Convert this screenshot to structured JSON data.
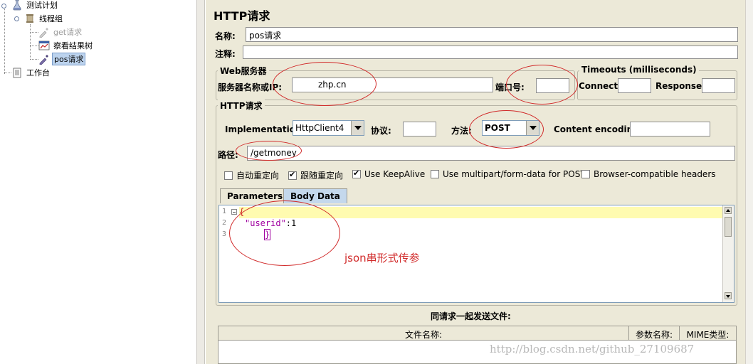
{
  "tree": {
    "test_plan": "测试计划",
    "thread_group": "线程组",
    "get_request": "get请求",
    "results_tree": "察看结果树",
    "pos_request": "pos请求",
    "workbench": "工作台"
  },
  "panel": {
    "title": "HTTP请求",
    "name_label": "名称:",
    "name_value": "pos请求",
    "comment_label": "注释:",
    "comment_value": "",
    "web_server_group": "Web服务器",
    "server_label": "服务器名称或IP:",
    "server_value": "zhp.cn",
    "port_label": "端口号:",
    "port_value": "",
    "timeouts_group": "Timeouts (milliseconds)",
    "connect_label": "Connect:",
    "connect_value": "",
    "response_label": "Response:",
    "response_value": "",
    "http_group": "HTTP请求",
    "implementation_label": "Implementation:",
    "implementation_value": "HttpClient4",
    "protocol_label": "协议:",
    "protocol_value": "",
    "method_label": "方法:",
    "method_value": "POST",
    "encoding_label": "Content encoding:",
    "encoding_value": "",
    "path_label": "路径:",
    "path_value": "/getmoney",
    "checkboxes": [
      {
        "label": "自动重定向",
        "checked": false
      },
      {
        "label": "跟随重定向",
        "checked": true
      },
      {
        "label": "Use KeepAlive",
        "checked": true
      },
      {
        "label": "Use multipart/form-data for POST",
        "checked": false
      },
      {
        "label": "Browser-compatible headers",
        "checked": false
      }
    ],
    "tabs": [
      "Parameters",
      "Body Data"
    ],
    "active_tab": "Body Data",
    "editor": {
      "line_numbers": [
        "1",
        "2",
        "3"
      ],
      "line1": "{",
      "line2_key": "\"userid\"",
      "line2_rest": ":1",
      "line3": "}"
    },
    "files_title": "同请求一起发送文件:",
    "file_columns": [
      "文件名称:",
      "参数名称:",
      "MIME类型:"
    ]
  },
  "annotation": "json串形式传参",
  "watermark": "http://blog.csdn.net/github_27109687",
  "colors": {
    "panel_bg": "#ece9d8",
    "annotation_red": "#d12a2a",
    "current_line": "#fffbb0",
    "json_key": "#a000a0",
    "selected_tree": "#bcd3ee",
    "active_tab": "#c4d8ec"
  }
}
